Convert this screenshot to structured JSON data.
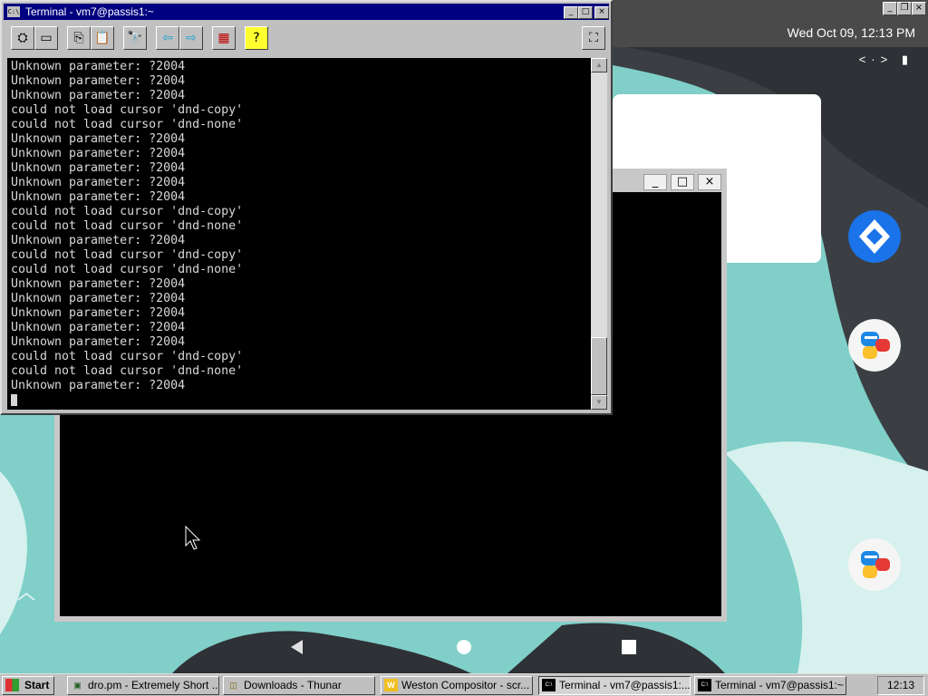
{
  "android": {
    "datetime": "Wed Oct 09, 12:13 PM",
    "status_icons": "<·> ▮",
    "topbar_buttons": [
      "_",
      "❐",
      "×"
    ]
  },
  "terminal1": {
    "title": "Terminal - vm7@passis1:~",
    "icon_text": "C:\\",
    "title_buttons": [
      "_",
      "□",
      "×"
    ],
    "toolbar_icons": [
      "select-icon",
      "fullscreen-icon",
      "copy-icon",
      "paste-icon",
      "find-icon",
      "back-icon",
      "forward-icon",
      "font-icon",
      "help-icon",
      "background-icon"
    ],
    "lines": [
      "Unknown parameter: ?2004",
      "Unknown parameter: ?2004",
      "Unknown parameter: ?2004",
      "could not load cursor 'dnd-copy'",
      "could not load cursor 'dnd-none'",
      "Unknown parameter: ?2004",
      "Unknown parameter: ?2004",
      "Unknown parameter: ?2004",
      "Unknown parameter: ?2004",
      "Unknown parameter: ?2004",
      "could not load cursor 'dnd-copy'",
      "could not load cursor 'dnd-none'",
      "Unknown parameter: ?2004",
      "could not load cursor 'dnd-copy'",
      "could not load cursor 'dnd-none'",
      "Unknown parameter: ?2004",
      "Unknown parameter: ?2004",
      "Unknown parameter: ?2004",
      "Unknown parameter: ?2004",
      "Unknown parameter: ?2004",
      "could not load cursor 'dnd-copy'",
      "could not load cursor 'dnd-none'",
      "Unknown parameter: ?2004"
    ]
  },
  "terminal2": {
    "buttons": [
      "_",
      "□",
      "×"
    ]
  },
  "taskbar": {
    "start_label": "Start",
    "items": [
      {
        "label": "dro.pm - Extremely Short ...",
        "icon": "globe-icon"
      },
      {
        "label": "Downloads - Thunar",
        "icon": "folder-icon"
      },
      {
        "label": "Weston Compositor - scr...",
        "icon": "weston-icon"
      },
      {
        "label": "Terminal - vm7@passis1:...",
        "icon": "terminal-icon"
      },
      {
        "label": "Terminal - vm7@passis1:~",
        "icon": "terminal-icon"
      }
    ],
    "clock": "12:13"
  },
  "colors": {
    "title_active": "#000080",
    "win_face": "#c0c0c0",
    "teal": "#7fcdc6",
    "dark_shape": "#2e3135"
  }
}
